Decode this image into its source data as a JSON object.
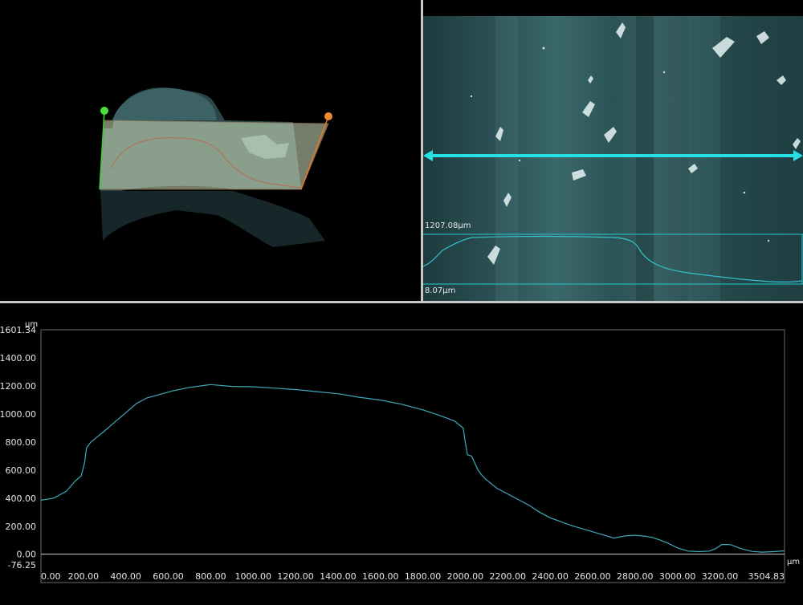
{
  "micro_view": {
    "upper_value": "1207.08µm",
    "lower_value": "8.07µm"
  },
  "chart_data": {
    "type": "line",
    "x_unit": "µm",
    "y_unit": "µm",
    "xlim": [
      0,
      3504.83
    ],
    "ylim": [
      -76.25,
      1601.34
    ],
    "y_max_label": "1601.34",
    "y_min_label": "-76.25",
    "x_max_label": "3504.83",
    "y_ticks": [
      "1400.00",
      "1200.00",
      "1000.00",
      "800.00",
      "600.00",
      "400.00",
      "200.00",
      "0.00"
    ],
    "x_ticks": [
      "0.00",
      "200.00",
      "400.00",
      "600.00",
      "800.00",
      "1000.00",
      "1200.00",
      "1400.00",
      "1600.00",
      "1800.00",
      "2000.00",
      "2200.00",
      "2400.00",
      "2600.00",
      "2800.00",
      "3000.00",
      "3200.00"
    ],
    "series_color": "#3fa9b8",
    "zero_line": true,
    "x": [
      0,
      60,
      120,
      160,
      190,
      205,
      215,
      235,
      260,
      300,
      350,
      400,
      450,
      500,
      560,
      620,
      700,
      800,
      900,
      1000,
      1100,
      1200,
      1300,
      1400,
      1500,
      1600,
      1700,
      1800,
      1880,
      1950,
      1990,
      2000,
      2010,
      2030,
      2060,
      2080,
      2100,
      2150,
      2200,
      2250,
      2300,
      2350,
      2400,
      2500,
      2600,
      2700,
      2750,
      2800,
      2840,
      2880,
      2920,
      2960,
      3000,
      3050,
      3100,
      3150,
      3180,
      3210,
      3250,
      3300,
      3350,
      3400,
      3450,
      3504
    ],
    "y": [
      385,
      400,
      450,
      520,
      560,
      650,
      760,
      800,
      830,
      880,
      945,
      1010,
      1075,
      1115,
      1140,
      1165,
      1190,
      1210,
      1197,
      1195,
      1185,
      1175,
      1160,
      1145,
      1120,
      1100,
      1070,
      1030,
      990,
      950,
      900,
      800,
      710,
      700,
      600,
      560,
      530,
      470,
      430,
      390,
      350,
      300,
      260,
      205,
      160,
      115,
      130,
      135,
      130,
      120,
      100,
      75,
      45,
      22,
      18,
      22,
      40,
      70,
      68,
      40,
      20,
      15,
      18,
      24
    ]
  }
}
